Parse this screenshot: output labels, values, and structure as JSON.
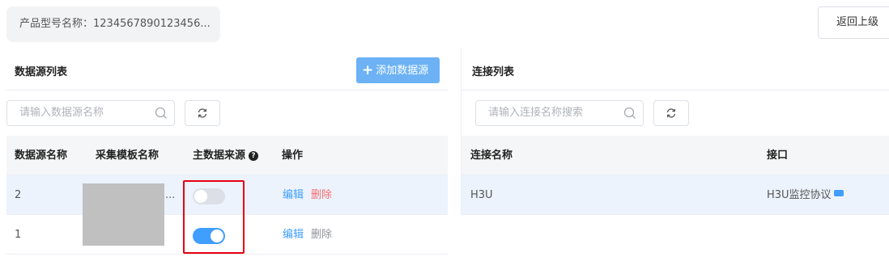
{
  "header": {
    "product_label": "产品型号名称：",
    "product_value": "1234567890123456...",
    "back_button": "返回上级"
  },
  "datasource": {
    "title": "数据源列表",
    "add_button": "添加数据源",
    "search_placeholder": "请输入数据源名称",
    "columns": [
      "数据源名称",
      "采集模板名称",
      "主数据来源",
      "操作"
    ],
    "rows": [
      {
        "name": "2",
        "template": "...",
        "primary": false,
        "edit": "编辑",
        "delete": "删除"
      },
      {
        "name": "1",
        "template": "",
        "primary": true,
        "edit": "编辑",
        "delete": "删除"
      }
    ]
  },
  "connection": {
    "title": "连接列表",
    "search_placeholder": "请输入连接名称搜索",
    "columns": [
      "连接名称",
      "接口"
    ],
    "rows": [
      {
        "name": "H3U",
        "interface": "H3U监控协议"
      }
    ]
  },
  "colors": {
    "accent": "#409eff",
    "add_button_bg": "#6cb2f5",
    "delete_red": "#f56c6c",
    "highlight_border": "#e60012",
    "selected_row": "#ecf3fd"
  }
}
